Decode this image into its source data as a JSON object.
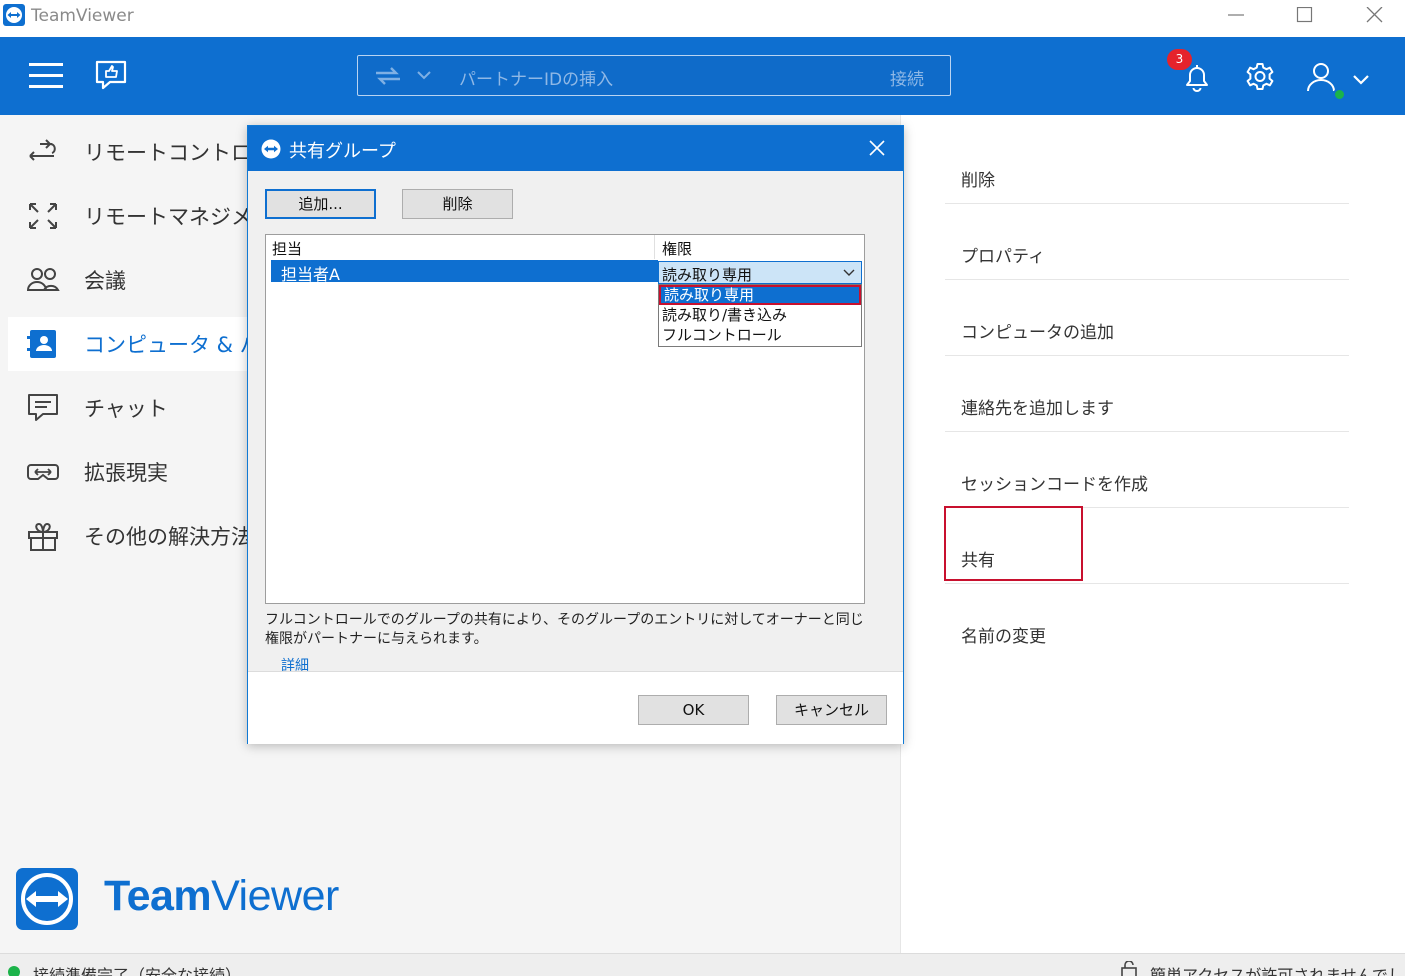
{
  "window": {
    "title": "TeamViewer"
  },
  "topbar": {
    "partner_placeholder": "パートナーIDの挿入",
    "connect_label": "接続",
    "notification_count": "3"
  },
  "sidebar": {
    "items": [
      {
        "label": "リモートコントロール",
        "icon": "remote-control-icon"
      },
      {
        "label": "リモートマネジメント",
        "icon": "remote-management-icon"
      },
      {
        "label": "会議",
        "icon": "meeting-icon"
      },
      {
        "label": "コンピュータ & パートナー",
        "icon": "contacts-icon",
        "active": true
      },
      {
        "label": "チャット",
        "icon": "chat-icon"
      },
      {
        "label": "拡張現実",
        "icon": "ar-icon"
      },
      {
        "label": "その他の解決方法",
        "icon": "gift-icon"
      }
    ],
    "logo_text_bold": "Team",
    "logo_text_regular": "Viewer"
  },
  "context_menu": {
    "items": [
      "削除",
      "プロパティ",
      "コンピュータの追加",
      "連絡先を追加します",
      "セッションコードを作成",
      "共有",
      "名前の変更"
    ]
  },
  "status": {
    "left": "接続準備完了（安全な接続）",
    "right": "簡単アクセスが許可されませんでした"
  },
  "dialog": {
    "title": "共有グループ",
    "add_button": "追加...",
    "delete_button": "削除",
    "column_user": "担当",
    "column_permission": "権限",
    "row_user": "担当者A",
    "row_permission": "読み取り専用",
    "permission_options": [
      "読み取り専用",
      "読み取り/書き込み",
      "フルコントロール"
    ],
    "selected_option": "読み取り専用",
    "info_text": "フルコントロールでのグループの共有により、そのグループのエントリに対してオーナーと同じ権限がパートナーに与えられます。",
    "details_link": "詳細",
    "ok_button": "OK",
    "cancel_button": "キャンセル"
  },
  "colors": {
    "brand_blue": "#0e6fd0",
    "highlight_red": "#c8102e",
    "online_green": "#1bb34a"
  }
}
